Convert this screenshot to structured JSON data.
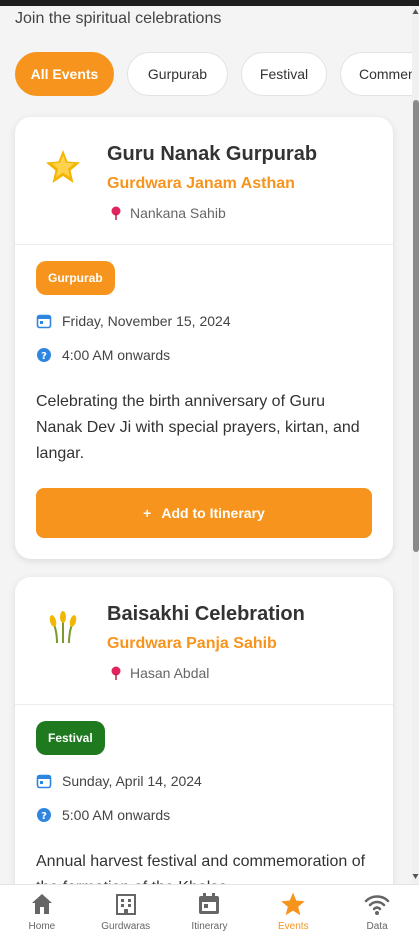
{
  "header": {
    "subtitle": "Join the spiritual celebrations"
  },
  "filters": [
    {
      "label": "All Events",
      "active": true
    },
    {
      "label": "Gurpurab",
      "active": false
    },
    {
      "label": "Festival",
      "active": false
    },
    {
      "label": "Commemoration",
      "active": false
    }
  ],
  "events": [
    {
      "title": "Guru Nanak Gurpurab",
      "gurdwara": "Gurdwara Janam Asthan",
      "location": "Nankana Sahib",
      "tag": "Gurpurab",
      "date": "Friday, November 15, 2024",
      "time": "4:00 AM onwards",
      "description": "Celebrating the birth anniversary of Guru Nanak Dev Ji with special prayers, kirtan, and langar.",
      "add_label": "Add to Itinerary",
      "emblem_icon": "star-icon"
    },
    {
      "title": "Baisakhi Celebration",
      "gurdwara": "Gurdwara Panja Sahib",
      "location": "Hasan Abdal",
      "tag": "Festival",
      "date": "Sunday, April 14, 2024",
      "time": "5:00 AM onwards",
      "description": "Annual harvest festival and commemoration of the formation of the Khalsa.",
      "emblem_icon": "wheat-icon"
    }
  ],
  "nav": [
    {
      "label": "Home",
      "icon": "home-icon",
      "active": false
    },
    {
      "label": "Gurdwaras",
      "icon": "building-icon",
      "active": false
    },
    {
      "label": "Itinerary",
      "icon": "calendar-icon",
      "active": false
    },
    {
      "label": "Events",
      "icon": "star-icon",
      "active": true
    },
    {
      "label": "Data",
      "icon": "wifi-icon",
      "active": false
    }
  ],
  "colors": {
    "accent": "#f7941d",
    "festival_tag": "#1f7a1f",
    "info_blue": "#2f86e0",
    "pin_red": "#e0245e"
  }
}
